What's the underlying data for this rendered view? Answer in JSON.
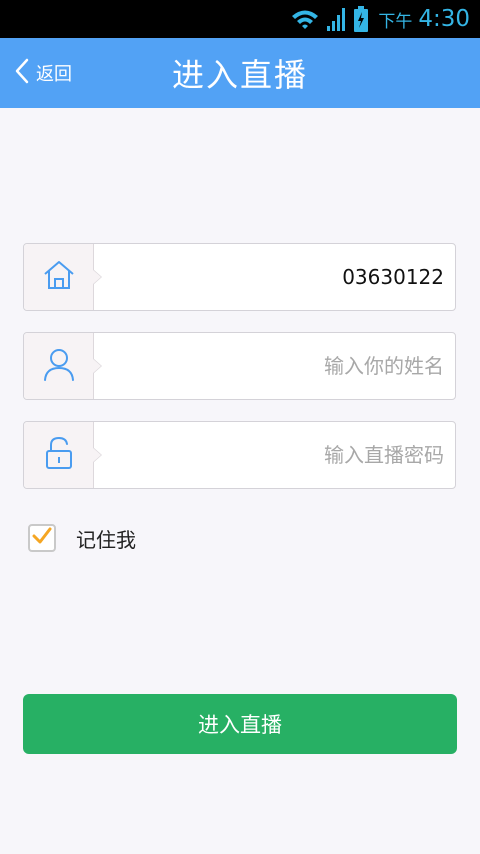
{
  "status_bar": {
    "time_prefix": "下午",
    "time": "4:30",
    "icons": [
      "wifi-icon",
      "signal-icon",
      "battery-icon"
    ]
  },
  "header": {
    "back_label": "返回",
    "title": "进入直播"
  },
  "form": {
    "room_field": {
      "icon": "home-icon",
      "value": "03630122",
      "placeholder": ""
    },
    "name_field": {
      "icon": "user-icon",
      "value": "",
      "placeholder": "输入你的姓名"
    },
    "password_field": {
      "icon": "lock-icon",
      "value": "",
      "placeholder": "输入直播密码"
    },
    "remember": {
      "label": "记住我",
      "checked": true
    },
    "submit_label": "进入直播"
  },
  "colors": {
    "header_bg": "#52a2f5",
    "accent_blue": "#4a9cf0",
    "submit_bg": "#27b064",
    "check_orange": "#f5a623",
    "status_blue": "#34b5e5"
  }
}
